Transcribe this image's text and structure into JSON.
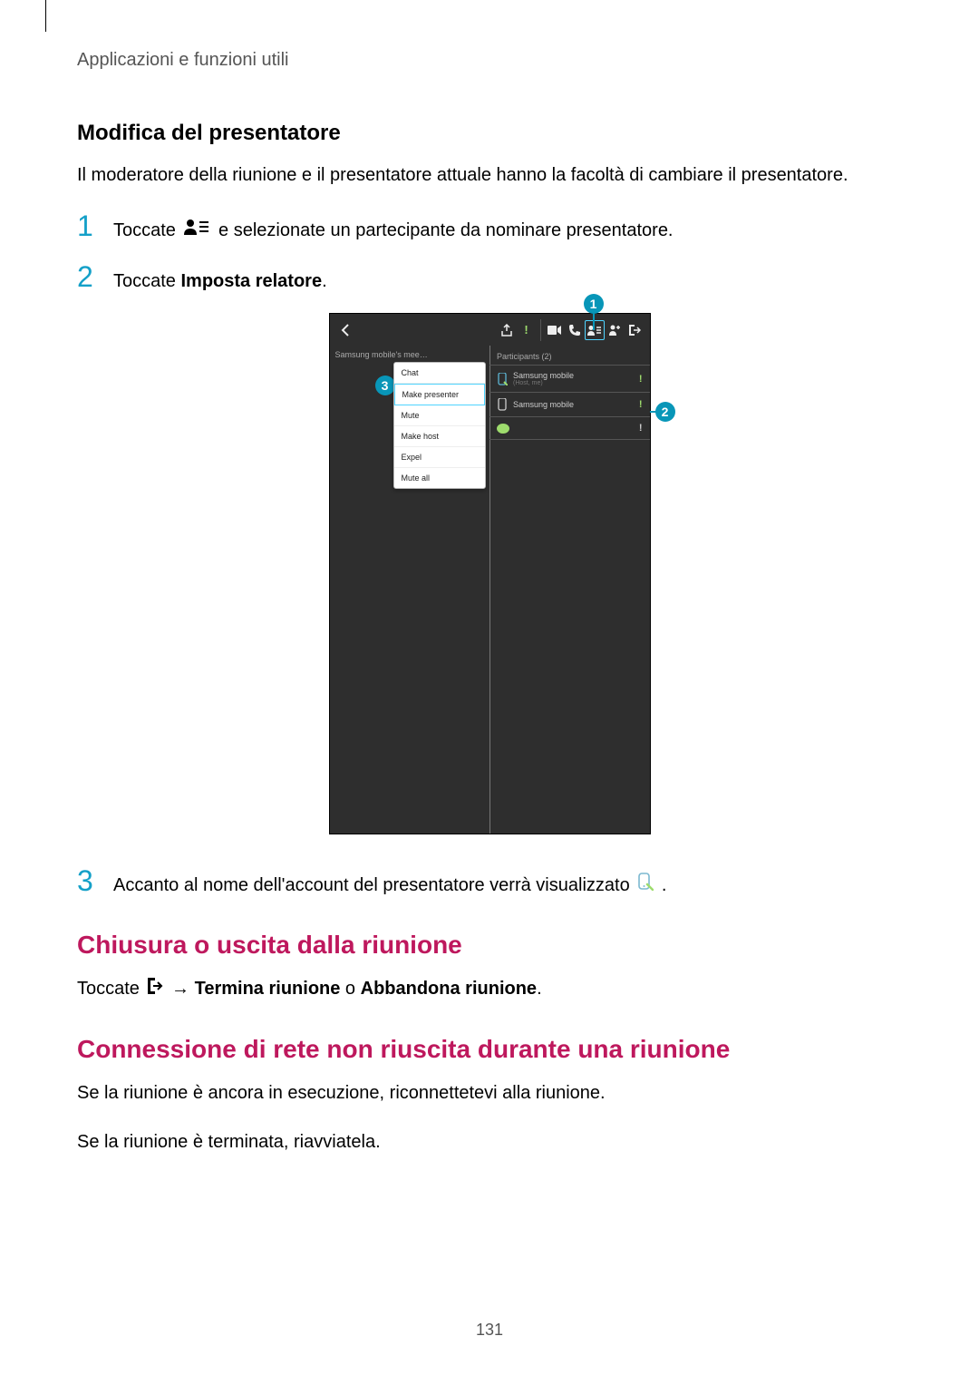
{
  "breadcrumb": "Applicazioni e funzioni utili",
  "s1": {
    "heading": "Modifica del presentatore",
    "intro": "Il moderatore della riunione e il presentatore attuale hanno la facoltà di cambiare il presentatore.",
    "step1_a": "Toccate ",
    "step1_b": " e selezionate un partecipante da nominare presentatore.",
    "step2_a": "Toccate ",
    "step2_b": "Imposta relatore",
    "step2_c": ".",
    "step3_a": "Accanto al nome dell'account del presentatore verrà visualizzato ",
    "step3_b": "."
  },
  "s2": {
    "heading": "Chiusura o uscita dalla riunione",
    "line_a": "Toccate ",
    "line_b": " → ",
    "line_c": "Termina riunione",
    "line_d": " o ",
    "line_e": "Abbandona riunione",
    "line_f": "."
  },
  "s3": {
    "heading": "Connessione di rete non riuscita durante una riunione",
    "p1": "Se la riunione è ancora in esecuzione, riconnettetevi alla riunione.",
    "p2": "Se la riunione è terminata, riavviatela."
  },
  "page_number": "131",
  "figure": {
    "callout1": "1",
    "callout2": "2",
    "callout3": "3",
    "meeting_text": "Samsung mobile's mee…",
    "menu": {
      "chat": "Chat",
      "make_presenter": "Make presenter",
      "mute": "Mute",
      "make_host": "Make host",
      "expel": "Expel",
      "mute_all": "Mute all"
    },
    "participants_header": "Participants (2)",
    "p1_name": "Samsung mobile",
    "p1_sub": "(Host, me)",
    "p2_name": "Samsung mobile"
  }
}
